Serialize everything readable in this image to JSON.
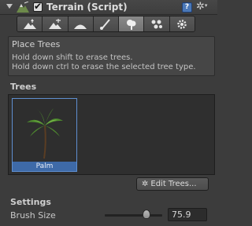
{
  "component": {
    "title": "Terrain (Script)",
    "enabled_mark": "✔",
    "help_glyph": "?",
    "icon": "terrain-icon"
  },
  "toolbar": {
    "tools": [
      {
        "name": "raise-lower-terrain-icon",
        "active": false
      },
      {
        "name": "paint-height-icon",
        "active": false
      },
      {
        "name": "smooth-height-icon",
        "active": false
      },
      {
        "name": "paint-texture-icon",
        "active": false
      },
      {
        "name": "place-trees-icon",
        "active": true
      },
      {
        "name": "paint-details-icon",
        "active": false
      },
      {
        "name": "terrain-settings-icon",
        "active": false
      }
    ]
  },
  "helpbox": {
    "title": "Place Trees",
    "line1": "Hold down shift to erase trees.",
    "line2": "Hold down ctrl to erase the selected tree type."
  },
  "trees": {
    "section_label": "Trees",
    "items": [
      {
        "name": "Palm",
        "selected": true
      }
    ],
    "edit_button_label": "Edit Trees..."
  },
  "settings": {
    "section_label": "Settings",
    "brush_size_label": "Brush Size",
    "brush_size_value": "75.9",
    "brush_size_fraction": 0.76
  },
  "colors": {
    "panel_bg": "#3c3c3c",
    "selection": "#3e6aa8",
    "active_tool": "#7e7e7e"
  }
}
